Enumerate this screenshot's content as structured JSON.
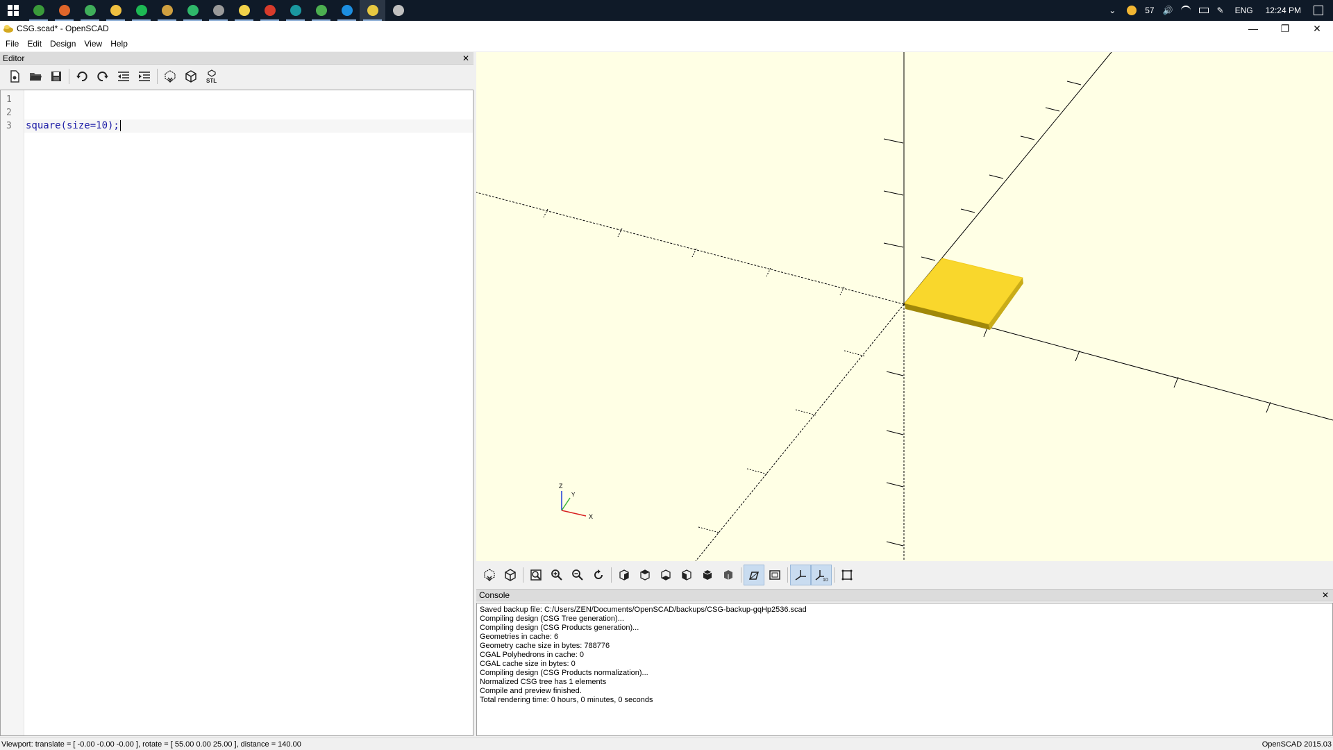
{
  "taskbar": {
    "apps": [
      {
        "name": "windows-start-icon"
      },
      {
        "name": "terminal-app-icon",
        "color": "#3a9a3a"
      },
      {
        "name": "firefox-icon",
        "color": "#e0662a"
      },
      {
        "name": "chrome-green-icon",
        "color": "#3fae5a"
      },
      {
        "name": "file-explorer-icon",
        "color": "#f0c040"
      },
      {
        "name": "spotify-icon",
        "color": "#1db954"
      },
      {
        "name": "git-app-icon",
        "color": "#d0a040"
      },
      {
        "name": "green-arrow-app-icon",
        "color": "#2fb86a"
      },
      {
        "name": "media-app-icon",
        "color": "#9a9a9a"
      },
      {
        "name": "sticky-notes-icon",
        "color": "#f2d24a"
      },
      {
        "name": "acrobat-icon",
        "color": "#d83b2b"
      },
      {
        "name": "arduino-icon",
        "color": "#1a98a0"
      },
      {
        "name": "green-circle-app-icon",
        "color": "#4caf50"
      },
      {
        "name": "skype-icon",
        "color": "#1c8ee0"
      },
      {
        "name": "openscad-taskbar-icon",
        "color": "#e8c840"
      },
      {
        "name": "globe-app-icon",
        "color": "#c0c0c0"
      }
    ],
    "tray": {
      "weather_temp": "57",
      "language": "ENG",
      "time": "12:24 PM"
    }
  },
  "window": {
    "title": "CSG.scad* - OpenSCAD",
    "minimize": "—",
    "restore": "❐",
    "close": "✕"
  },
  "menu": [
    "File",
    "Edit",
    "Design",
    "View",
    "Help"
  ],
  "editor": {
    "panel_title": "Editor",
    "close": "✕",
    "line_numbers": [
      "1",
      "2",
      "3"
    ],
    "code_lines": [
      "",
      "",
      "square(size=10);"
    ],
    "toolbar": [
      {
        "name": "new-file-icon"
      },
      {
        "name": "open-file-icon"
      },
      {
        "name": "save-file-icon"
      },
      {
        "name": "undo-icon"
      },
      {
        "name": "redo-icon"
      },
      {
        "name": "unindent-icon"
      },
      {
        "name": "indent-icon"
      },
      {
        "name": "preview-icon"
      },
      {
        "name": "render-icon"
      },
      {
        "name": "export-stl-icon"
      }
    ],
    "stl_label": "STL"
  },
  "viewport_axes": {
    "z_label": "Z",
    "y_label": "Y",
    "x_label": "X",
    "model_color": "#f9d72c"
  },
  "view_toolbar": [
    {
      "name": "preview-icon",
      "on": false
    },
    {
      "name": "render-icon",
      "on": false
    },
    {
      "name": "view-all-icon",
      "on": false
    },
    {
      "name": "zoom-in-icon",
      "on": false
    },
    {
      "name": "zoom-out-icon",
      "on": false
    },
    {
      "name": "reset-view-icon",
      "on": false
    },
    {
      "name": "view-right-icon",
      "on": false
    },
    {
      "name": "view-top-icon",
      "on": false
    },
    {
      "name": "view-bottom-icon",
      "on": false
    },
    {
      "name": "view-left-icon",
      "on": false
    },
    {
      "name": "view-front-icon",
      "on": false
    },
    {
      "name": "view-back-icon",
      "on": false
    },
    {
      "name": "perspective-icon",
      "on": true
    },
    {
      "name": "orthogonal-icon",
      "on": false
    },
    {
      "name": "show-axes-icon",
      "on": true
    },
    {
      "name": "show-scale-markers-icon",
      "on": true
    },
    {
      "name": "show-edges-icon",
      "on": false
    }
  ],
  "console": {
    "panel_title": "Console",
    "close": "✕",
    "lines": [
      "Saved backup file: C:/Users/ZEN/Documents/OpenSCAD/backups/CSG-backup-gqHp2536.scad",
      "Compiling design (CSG Tree generation)...",
      "Compiling design (CSG Products generation)...",
      "Geometries in cache: 6",
      "Geometry cache size in bytes: 788776",
      "CGAL Polyhedrons in cache: 0",
      "CGAL cache size in bytes: 0",
      "Compiling design (CSG Products normalization)...",
      "Normalized CSG tree has 1 elements",
      "Compile and preview finished.",
      "Total rendering time: 0 hours, 0 minutes, 0 seconds"
    ]
  },
  "status": {
    "viewport": "Viewport: translate = [ -0.00 -0.00 -0.00 ], rotate = [ 55.00 0.00 25.00 ], distance = 140.00",
    "version": "OpenSCAD 2015.03"
  }
}
